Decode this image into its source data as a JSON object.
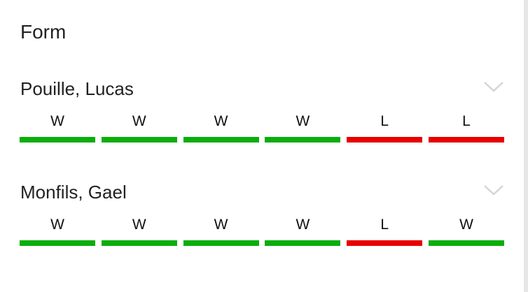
{
  "title": "Form",
  "colors": {
    "win": "#0aae0a",
    "loss": "#e80000",
    "chevron": "#d5d5d5"
  },
  "players": [
    {
      "name": "Pouille, Lucas",
      "results": [
        "W",
        "W",
        "W",
        "W",
        "L",
        "L"
      ]
    },
    {
      "name": "Monfils, Gael",
      "results": [
        "W",
        "W",
        "W",
        "W",
        "L",
        "W"
      ]
    }
  ]
}
